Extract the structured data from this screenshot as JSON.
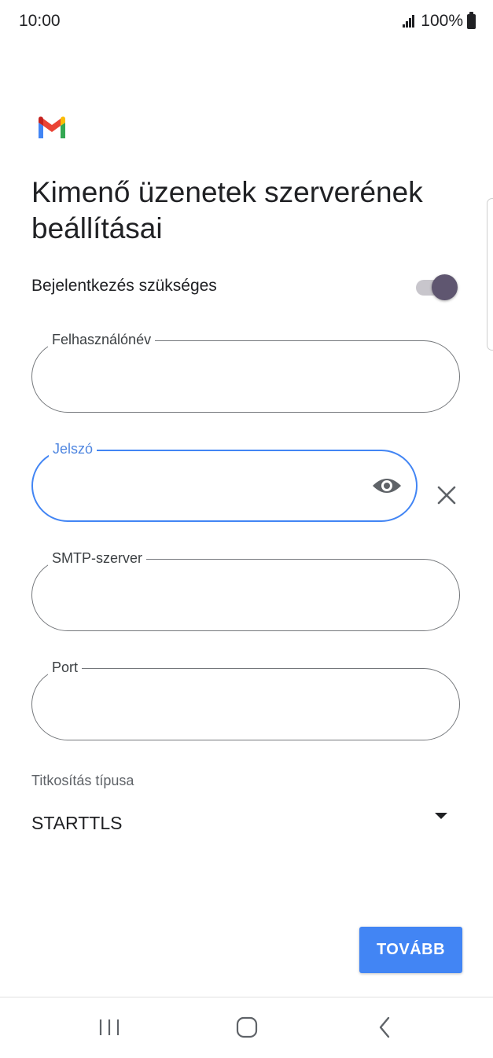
{
  "status_bar": {
    "time": "10:00",
    "battery": "100%"
  },
  "app": {
    "logo": "gmail-logo-icon"
  },
  "page": {
    "title": "Kimenő üzenetek szerverének beállításai"
  },
  "login_required": {
    "label": "Bejelentkezés szükséges",
    "enabled": true
  },
  "fields": {
    "username": {
      "label": "Felhasználónév",
      "value": ""
    },
    "password": {
      "label": "Jelszó",
      "value": ""
    },
    "smtp_server": {
      "label": "SMTP-szerver",
      "value": ""
    },
    "port": {
      "label": "Port",
      "value": ""
    }
  },
  "encryption": {
    "label": "Titkosítás típusa",
    "selected": "STARTTLS"
  },
  "actions": {
    "next_label": "TOVÁBB"
  },
  "colors": {
    "accent": "#4285f4",
    "toggle_thumb": "#5f5670"
  },
  "nav": {
    "icons": [
      "recent-apps-icon",
      "home-icon",
      "back-icon"
    ]
  }
}
